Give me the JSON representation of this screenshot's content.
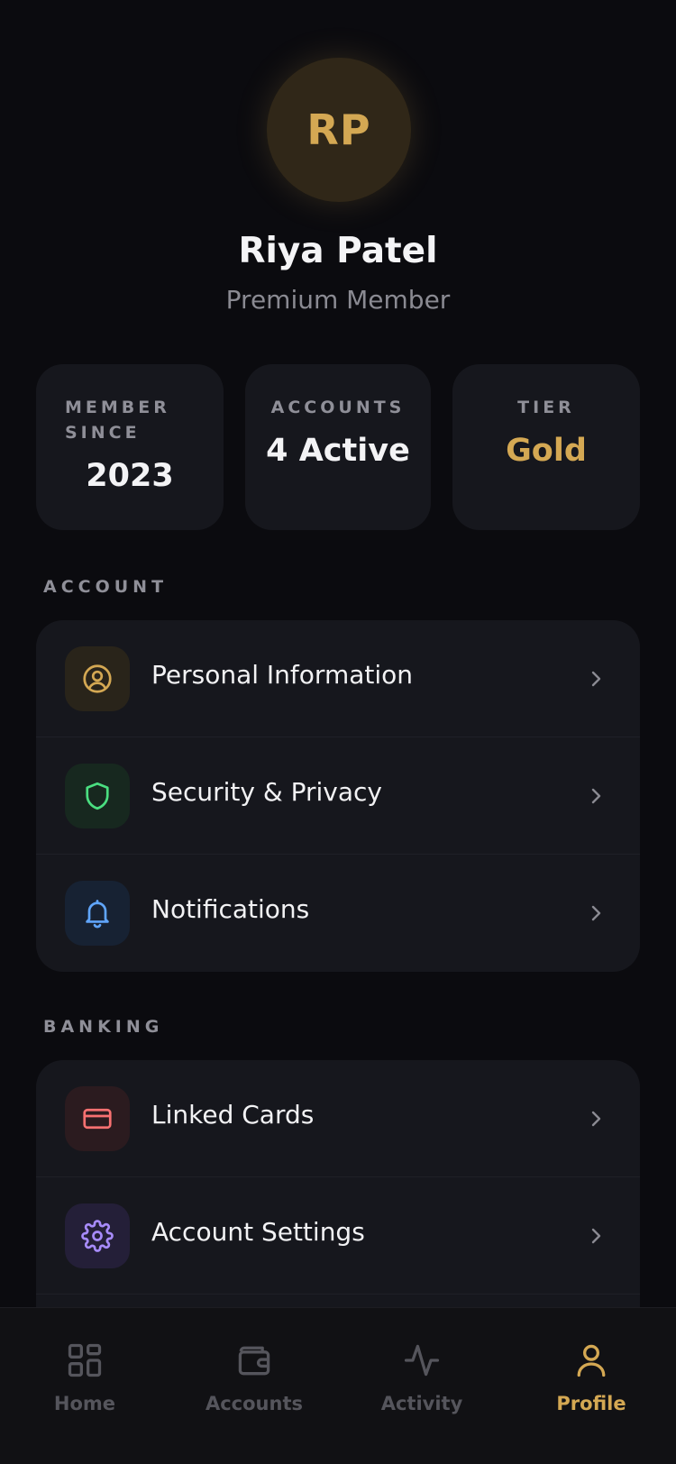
{
  "profile": {
    "initials": "RP",
    "name": "Riya Patel",
    "membership": "Premium Member"
  },
  "stats": [
    {
      "label": "MEMBER SINCE",
      "value": "2023"
    },
    {
      "label": "ACCOUNTS",
      "value": "4 Active"
    },
    {
      "label": "TIER",
      "value": "Gold"
    }
  ],
  "sections": [
    {
      "title": "ACCOUNT",
      "items": [
        {
          "label": "Personal Information",
          "icon": "user-circle-icon",
          "color": "#d4a853"
        },
        {
          "label": "Security & Privacy",
          "icon": "shield-icon",
          "color": "#4ade80"
        },
        {
          "label": "Notifications",
          "icon": "bell-icon",
          "color": "#60a5fa"
        }
      ]
    },
    {
      "title": "BANKING",
      "items": [
        {
          "label": "Linked Cards",
          "icon": "credit-card-icon",
          "color": "#f87171"
        },
        {
          "label": "Account Settings",
          "icon": "gear-icon",
          "color": "#a78bfa"
        }
      ]
    }
  ],
  "nav": {
    "items": [
      {
        "label": "Home",
        "icon": "grid-icon"
      },
      {
        "label": "Accounts",
        "icon": "wallet-icon"
      },
      {
        "label": "Activity",
        "icon": "activity-icon"
      },
      {
        "label": "Profile",
        "icon": "user-icon"
      }
    ],
    "active": "Profile"
  },
  "colors": {
    "background": "#0b0b0f",
    "card": "#16171d",
    "accent": "#d4a853",
    "muted": "#8f8f98"
  }
}
